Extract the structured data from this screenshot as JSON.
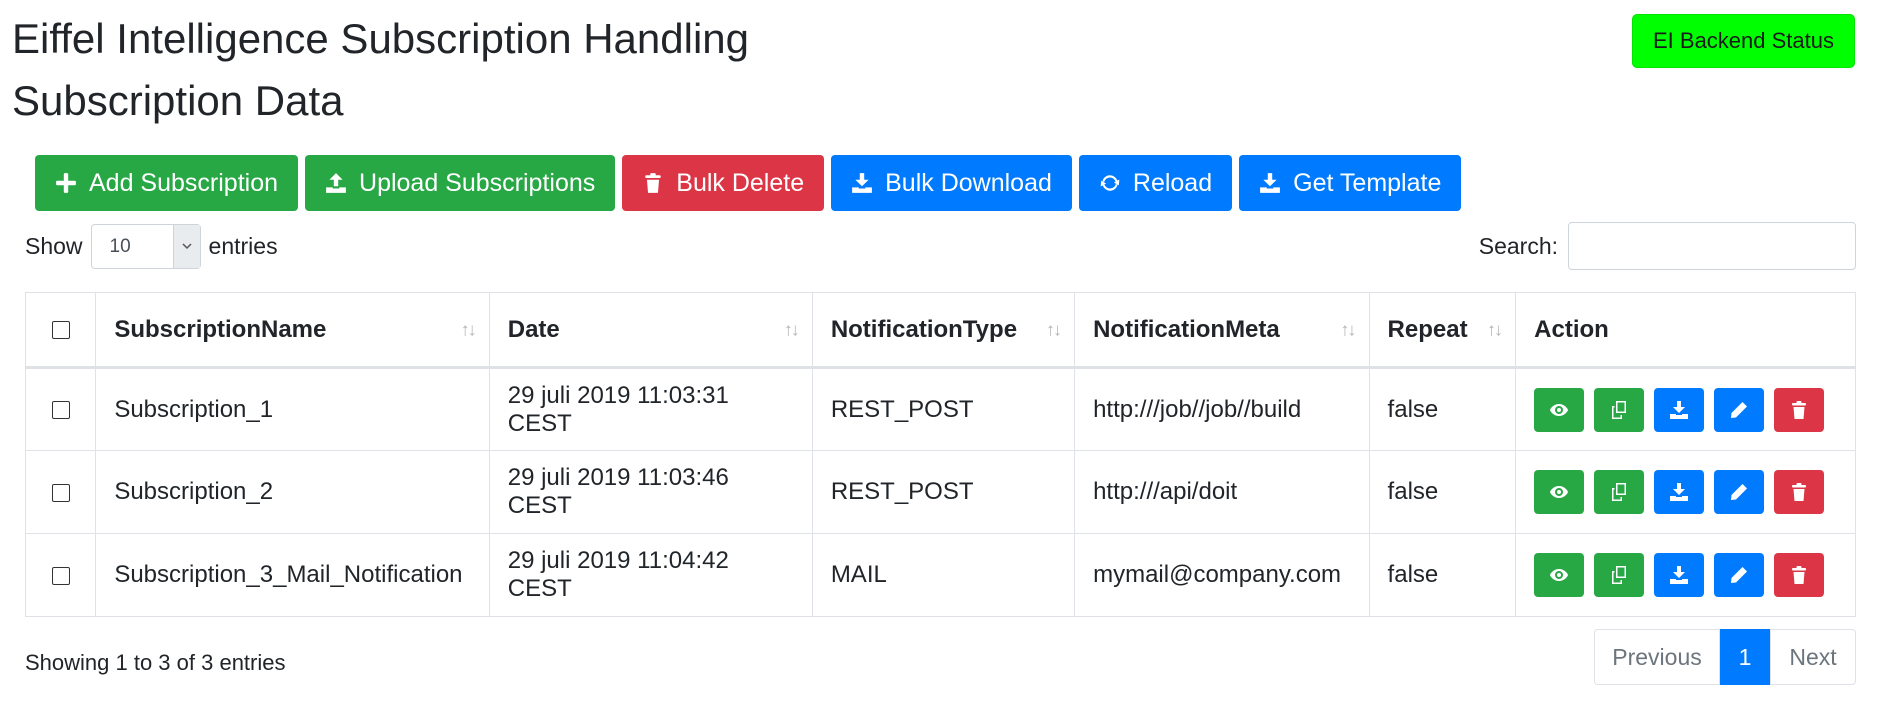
{
  "header": {
    "title": "Eiffel Intelligence Subscription Handling",
    "subtitle": "Subscription Data",
    "status_button": "EI Backend Status"
  },
  "toolbar": {
    "add": "Add Subscription",
    "upload": "Upload Subscriptions",
    "bulk_delete": "Bulk Delete",
    "bulk_download": "Bulk Download",
    "reload": "Reload",
    "get_template": "Get Template"
  },
  "length_menu": {
    "show": "Show",
    "value": "10",
    "entries": "entries"
  },
  "search": {
    "label": "Search:",
    "value": ""
  },
  "table": {
    "columns": [
      "SubscriptionName",
      "Date",
      "NotificationType",
      "NotificationMeta",
      "Repeat",
      "Action"
    ],
    "rows": [
      {
        "name": "Subscription_1",
        "date": "29 juli 2019 11:03:31 CEST",
        "type": "REST_POST",
        "meta": "http:///job//job//build",
        "repeat": "false"
      },
      {
        "name": "Subscription_2",
        "date": "29 juli 2019 11:03:46 CEST",
        "type": "REST_POST",
        "meta": "http:///api/doit",
        "repeat": "false"
      },
      {
        "name": "Subscription_3_Mail_Notification",
        "date": "29 juli 2019 11:04:42 CEST",
        "type": "MAIL",
        "meta": "mymail@company.com",
        "repeat": "false"
      }
    ],
    "row_actions": [
      "eye-icon",
      "copy-icon",
      "download-icon",
      "pencil-icon",
      "trash-icon"
    ]
  },
  "footer": {
    "info": "Showing 1 to 3 of 3 entries",
    "previous": "Previous",
    "page": "1",
    "next": "Next"
  },
  "colors": {
    "success": "#28a745",
    "danger": "#dc3545",
    "primary": "#007bff",
    "status": "#00ff00"
  }
}
